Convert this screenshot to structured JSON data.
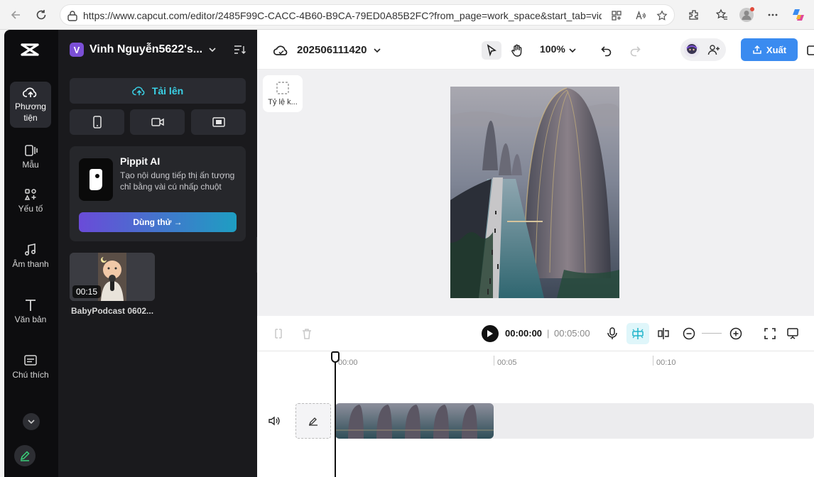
{
  "browser": {
    "url": "https://www.capcut.com/editor/2485F99C-CACC-4B60-B9CA-79ED0A85B2FC?from_page=work_space&start_tab=vid..."
  },
  "rail": {
    "items": [
      {
        "label": "Phương tiện",
        "icon": "cloud-upload-icon",
        "active": true
      },
      {
        "label": "Mẫu",
        "icon": "template-icon"
      },
      {
        "label": "Yếu tố",
        "icon": "elements-icon"
      },
      {
        "label": "Âm thanh",
        "icon": "music-note-icon"
      },
      {
        "label": "Văn bản",
        "icon": "text-icon"
      },
      {
        "label": "Chú thích",
        "icon": "captions-icon"
      }
    ]
  },
  "panel": {
    "workspace_initial": "V",
    "workspace_name": "Vinh Nguyễn5622's...",
    "upload_label": "Tải lên",
    "pippit": {
      "title": "Pippit AI",
      "description": "Tạo nội dung tiếp thị ấn tượng chỉ bằng vài cú nhấp chuột",
      "button": "Dùng thử →"
    },
    "media": [
      {
        "duration": "00:15",
        "name": "BabyPodcast 0602..."
      }
    ]
  },
  "topbar": {
    "project_name": "202506111420",
    "zoom": "100%",
    "export_label": "Xuất"
  },
  "canvas": {
    "ratio_label": "Tỷ lệ k..."
  },
  "player": {
    "current_time": "00:00:00",
    "separator": "|",
    "total_time": "00:05:00"
  },
  "timeline": {
    "ticks": [
      "00:00",
      "00:05",
      "00:10"
    ]
  },
  "colors": {
    "accent": "#3ad1e6",
    "export": "#3a8bf0",
    "rail_bg": "#0d0d0f",
    "panel_bg": "#1a1a1d"
  }
}
